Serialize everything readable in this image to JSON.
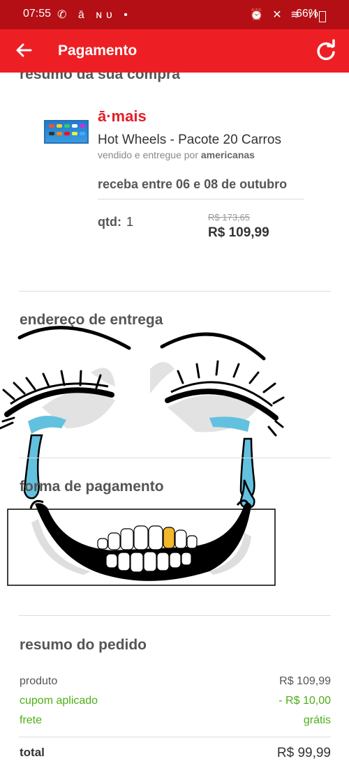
{
  "status_bar": {
    "time": "07:55",
    "battery": "66%"
  },
  "app_bar": {
    "title": "Pagamento"
  },
  "purchase_summary": {
    "title": "resumo da sua compra",
    "brand": "ā·mais",
    "product_name": "Hot Wheels - Pacote 20 Carros",
    "seller_prefix": "vendido e entregue por",
    "seller_name": "americanas",
    "delivery": "receba entre 06 e 08 de outubro",
    "qty_label": "qtd:",
    "qty_value": "1",
    "old_price": "R$ 173,65",
    "price": "R$ 109,99"
  },
  "delivery_address": {
    "title": "endereço de entrega"
  },
  "payment_method": {
    "title": "forma de pagamento"
  },
  "order_summary": {
    "title": "resumo do pedido",
    "rows": [
      {
        "label": "produto",
        "value": "R$ 109,99"
      },
      {
        "label": "cupom aplicado",
        "value": "- R$ 10,00"
      },
      {
        "label": "frete",
        "value": "grátis"
      }
    ],
    "total_label": "total",
    "total_value": "R$ 99,99"
  },
  "colors": {
    "header": "#ed1f24",
    "status_bar": "#b30f14",
    "accent_green": "#4caf16"
  }
}
